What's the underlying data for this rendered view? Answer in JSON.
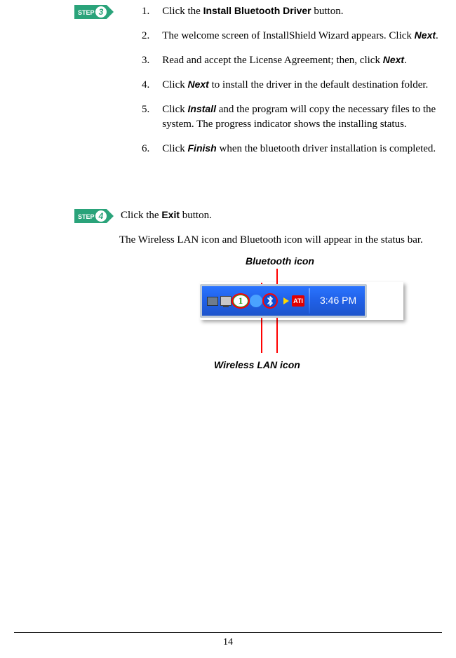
{
  "step3": {
    "badge_text": "STEP",
    "badge_num": "3",
    "items": [
      {
        "num": "1.",
        "pre": "Click the ",
        "bold": "Install Bluetooth Driver",
        "post": " button."
      },
      {
        "num": "2.",
        "pre": "The welcome screen of InstallShield Wizard appears. Click ",
        "bold": "Next",
        "post": "."
      },
      {
        "num": "3.",
        "pre": "Read and accept the License Agreement; then, click ",
        "bold": "Next",
        "post": "."
      },
      {
        "num": "4.",
        "pre": "Click ",
        "bold": "Next",
        "post": " to install the driver in the default destination folder."
      },
      {
        "num": "5.",
        "pre": "Click ",
        "bold": "Install",
        "post": " and the program will copy the necessary files to the system.  The progress indicator shows the installing status."
      },
      {
        "num": "6.",
        "pre": "Click ",
        "bold": "Finish",
        "post": " when the bluetooth driver installation is completed."
      }
    ]
  },
  "step4": {
    "badge_text": "STEP",
    "badge_num": "4",
    "line_pre": "Click the ",
    "line_bold": "Exit",
    "line_post": " button.",
    "para": "The Wireless LAN icon and Bluetooth icon will appear in the status bar."
  },
  "diagram": {
    "bt_label": "Bluetooth icon",
    "wl_label": "Wireless LAN icon"
  },
  "tray": {
    "net_label": "1",
    "bt_glyph": "࿖",
    "ati_label": "ATI",
    "time": "3:46 PM"
  },
  "page_number": "14"
}
